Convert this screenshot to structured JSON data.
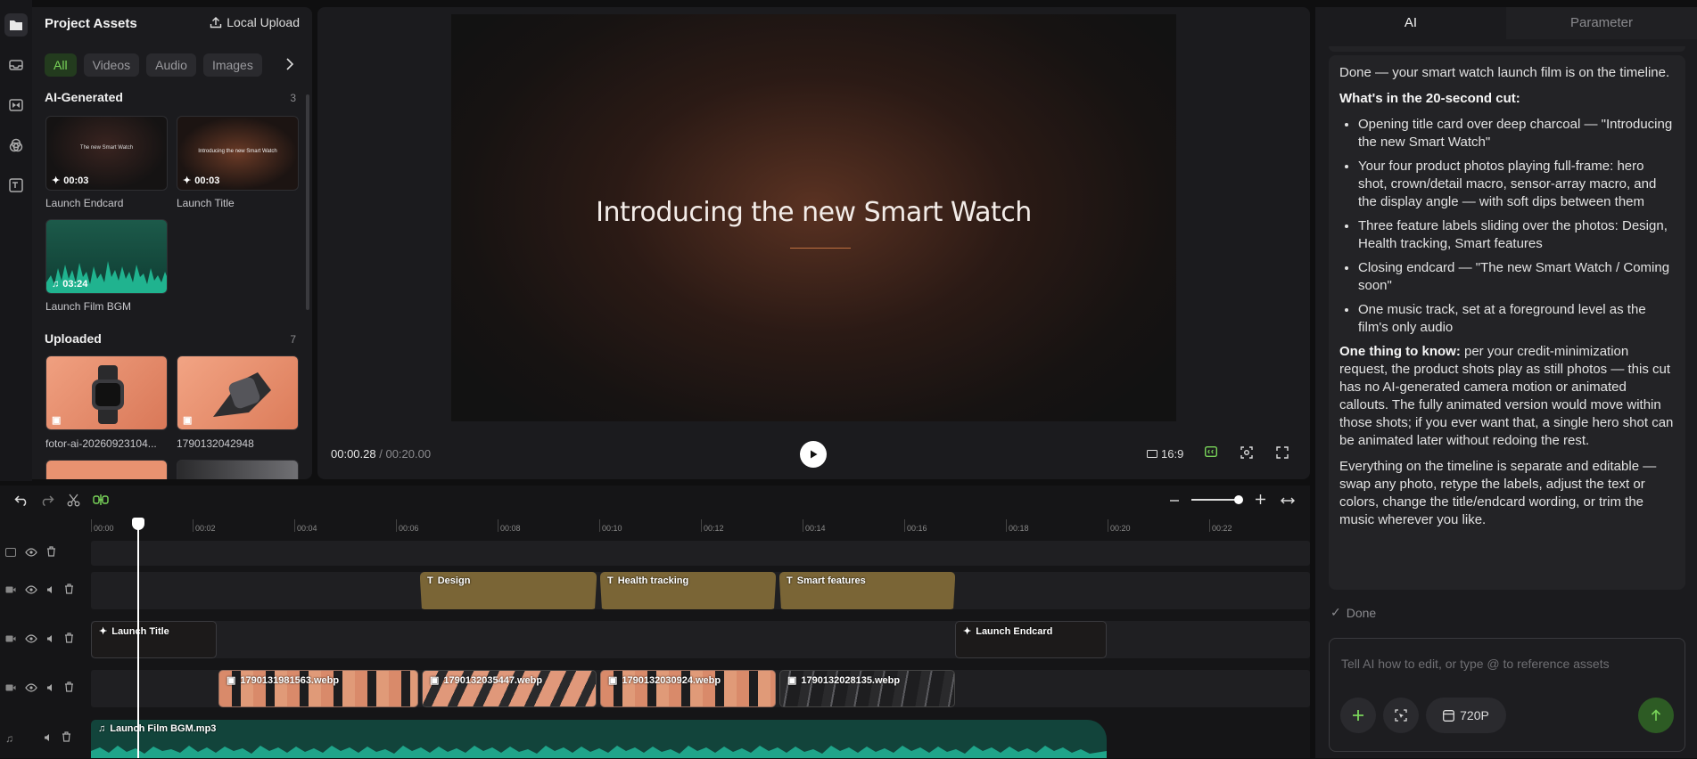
{
  "assets": {
    "title": "Project Assets",
    "upload_label": "Local Upload",
    "filters": [
      "All",
      "Videos",
      "Audio",
      "Images"
    ],
    "ai_section": {
      "label": "AI-Generated",
      "count": "3"
    },
    "uploaded_section": {
      "label": "Uploaded",
      "count": "7"
    },
    "ai_items": [
      {
        "name": "Launch Endcard",
        "duration": "00:03",
        "preview_text": "The new Smart Watch"
      },
      {
        "name": "Launch Title",
        "duration": "00:03",
        "preview_text": "Introducing the new Smart Watch"
      },
      {
        "name": "Launch Film BGM",
        "duration": "03:24"
      }
    ],
    "uploaded_items": [
      {
        "name": "fotor-ai-20260923104..."
      },
      {
        "name": "1790132042948"
      }
    ]
  },
  "preview": {
    "headline": "Introducing the new Smart Watch",
    "current_time": "00:00.28",
    "total_time": "/ 00:20.00",
    "aspect": "16:9"
  },
  "ai_panel": {
    "tabs": [
      "AI",
      "Parameter"
    ],
    "message": {
      "intro": "Done — your smart watch launch film is on the timeline.",
      "heading": "What's in the 20-second cut:",
      "bullets": [
        "Opening title card over deep charcoal — \"Introducing the new Smart Watch\"",
        "Your four product photos playing full-frame: hero shot, crown/detail macro, sensor-array macro, and the display angle — with soft dips between them",
        "Three feature labels sliding over the photos: Design, Health tracking, Smart features",
        "Closing endcard — \"The new Smart Watch / Coming soon\"",
        "One music track, set at a foreground level as the film's only audio"
      ],
      "note_label": "One thing to know:",
      "note_text": " per your credit-minimization request, the product shots play as still photos — this cut has no AI-generated camera motion or animated callouts. The fully animated version would move within those shots; if you ever want that, a single hero shot can be animated later without redoing the rest.",
      "closing": "Everything on the timeline is separate and editable — swap any photo, retype the labels, adjust the text or colors, change the title/endcard wording, or trim the music wherever you like."
    },
    "status": "Done",
    "input_placeholder": "Tell AI how to edit, or type @ to reference assets",
    "resolution": "720P"
  },
  "timeline": {
    "ticks": [
      "00:00",
      "00:02",
      "00:04",
      "00:06",
      "00:08",
      "00:10",
      "00:12",
      "00:14",
      "00:16",
      "00:18",
      "00:20",
      "00:22"
    ],
    "text_clips": [
      "Design",
      "Health tracking",
      "Smart features"
    ],
    "title_clips": [
      "Launch Title",
      "Launch Endcard"
    ],
    "image_clips": [
      "1790131981563.webp",
      "1790132035447.webp",
      "1790132030924.webp",
      "1790132028135.webp"
    ],
    "audio_clip": "Launch Film BGM.mp3",
    "playhead_time_s": 0.28,
    "text_glyph": "T"
  },
  "colors": {
    "accent": "#7ad65a",
    "text_clip": "#7a6536",
    "audio_clip": "#12443b",
    "send": "#2d5b24"
  }
}
